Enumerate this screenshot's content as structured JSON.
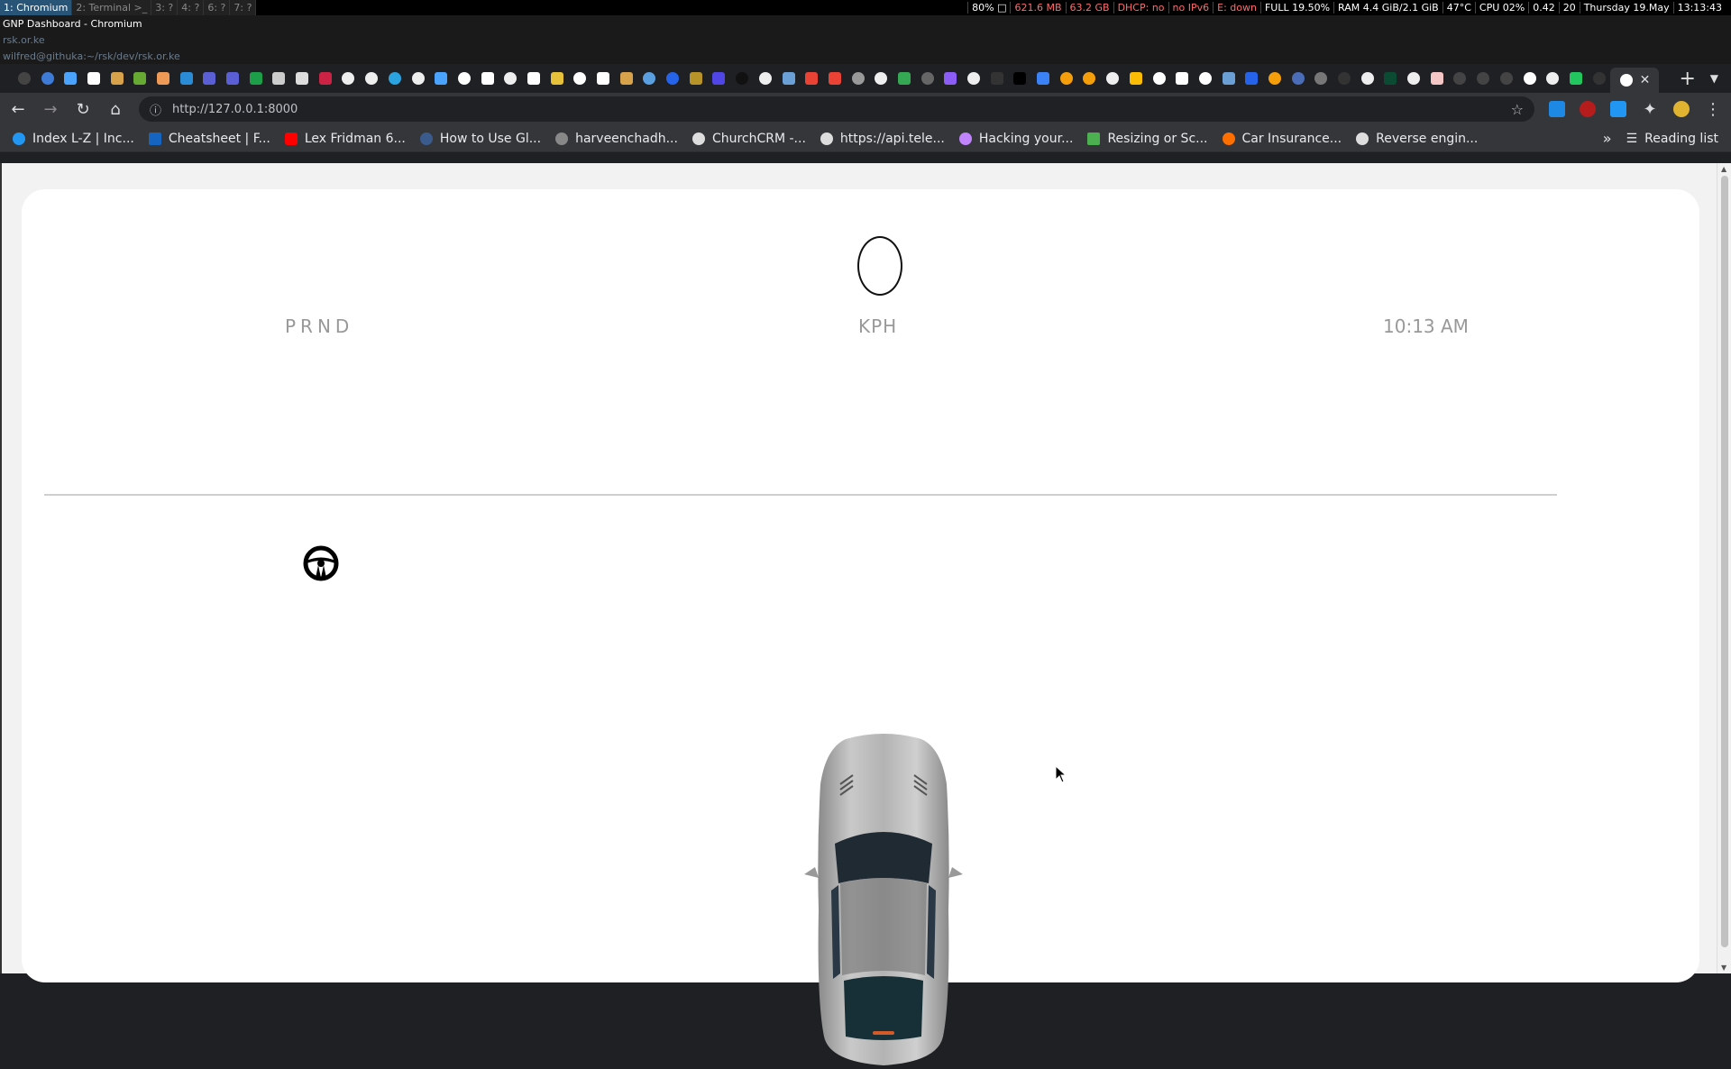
{
  "i3": {
    "workspaces": [
      "1: Chromium",
      "2: Terminal >_",
      "3: ?",
      "4: ?",
      "6: ?",
      "7: ?"
    ],
    "status": [
      "80% □",
      "621.6 MB",
      "63.2 GB",
      "DHCP: no",
      "no IPv6",
      "E: down",
      "FULL 19.50%",
      "RAM 4.4 GiB/2.1 GiB",
      "47°C",
      "CPU 02%",
      "0.42",
      "20",
      "Thursday 19.May",
      "13:13:43"
    ]
  },
  "window": {
    "title": "GNP Dashboard - Chromium",
    "line1": "rsk.or.ke",
    "line2": "wilfred@githuka:~/rsk/dev/rsk.or.ke"
  },
  "browser": {
    "url": "http://127.0.0.1:8000",
    "bookmarks": [
      "Index L-Z | Inc...",
      "Cheatsheet | F...",
      "Lex Fridman 6...",
      "How to Use Gl...",
      "harveenchadh...",
      "ChurchCRM -...",
      "https://api.tele...",
      "Hacking your...",
      "Resizing or Sc...",
      "Car Insurance...",
      "Reverse engin..."
    ],
    "reading_list": "Reading list",
    "icons": {
      "back": "arrow-left-icon",
      "forward": "arrow-right-icon",
      "reload": "reload-icon",
      "home": "home-icon",
      "info": "info-icon",
      "star": "star-icon",
      "extensions": "puzzle-icon",
      "menu": "kebab-menu-icon"
    }
  },
  "dashboard": {
    "gear": "PRND",
    "speed_unit": "KPH",
    "time": "10:13 AM",
    "speed": "0",
    "wheel_icon": "steering-wheel-icon",
    "car_image": "car-top-view"
  },
  "colors": {
    "accent": "#285577",
    "page_bg": "#f2f2f2",
    "card": "#ffffff",
    "label": "#999999"
  }
}
